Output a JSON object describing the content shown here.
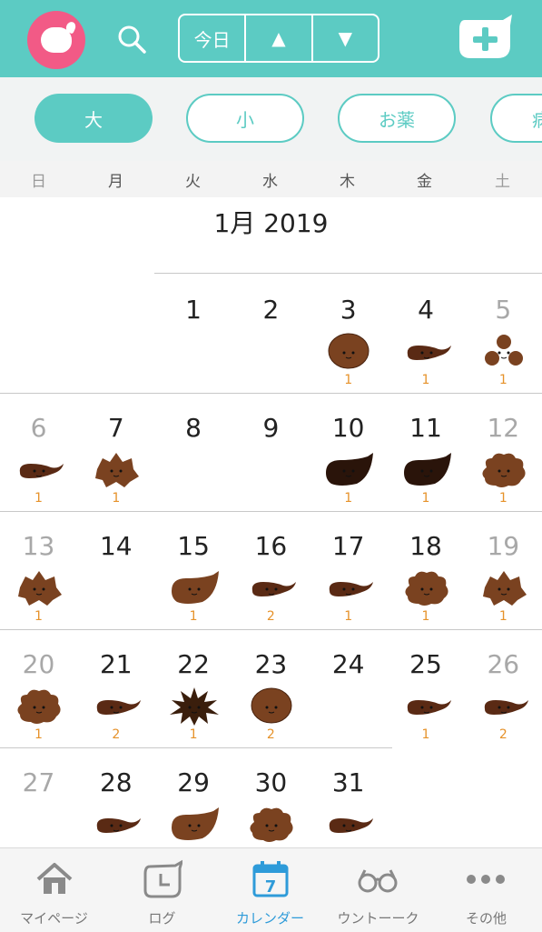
{
  "header": {
    "today_label": "今日",
    "prev_label": "▲",
    "next_label": "▼",
    "accent_color": "#5ccbc3",
    "app_icon_color": "#f25a86"
  },
  "filters": [
    "大",
    "小",
    "お薬",
    "病"
  ],
  "weekdays": [
    "日",
    "月",
    "火",
    "水",
    "木",
    "金",
    "土"
  ],
  "month_title": "1月 2019",
  "days": [
    {
      "day": "1"
    },
    {
      "day": "2"
    },
    {
      "day": "3",
      "type": "round",
      "count": "1"
    },
    {
      "day": "4",
      "type": "tadpole",
      "count": "1"
    },
    {
      "day": "5",
      "type": "pellets",
      "count": "1"
    },
    {
      "day": "6",
      "type": "tadpole",
      "count": "1"
    },
    {
      "day": "7",
      "type": "spiky",
      "count": "1"
    },
    {
      "day": "8"
    },
    {
      "day": "9"
    },
    {
      "day": "10",
      "type": "blob-dark",
      "count": "1"
    },
    {
      "day": "11",
      "type": "blob-dark",
      "count": "1"
    },
    {
      "day": "12",
      "type": "lumpy",
      "count": "1"
    },
    {
      "day": "13",
      "type": "spiky",
      "count": "1"
    },
    {
      "day": "14"
    },
    {
      "day": "15",
      "type": "blob",
      "count": "1"
    },
    {
      "day": "16",
      "type": "tadpole",
      "count": "2"
    },
    {
      "day": "17",
      "type": "tadpole",
      "count": "1"
    },
    {
      "day": "18",
      "type": "lumpy",
      "count": "1"
    },
    {
      "day": "19",
      "type": "spiky",
      "count": "1"
    },
    {
      "day": "20",
      "type": "lumpy",
      "count": "1"
    },
    {
      "day": "21",
      "type": "tadpole",
      "count": "2"
    },
    {
      "day": "22",
      "type": "burst",
      "count": "1"
    },
    {
      "day": "23",
      "type": "round",
      "count": "2"
    },
    {
      "day": "24"
    },
    {
      "day": "25",
      "type": "tadpole",
      "count": "1"
    },
    {
      "day": "26",
      "type": "tadpole",
      "count": "2"
    },
    {
      "day": "27"
    },
    {
      "day": "28",
      "type": "tadpole"
    },
    {
      "day": "29",
      "type": "blob"
    },
    {
      "day": "30",
      "type": "lumpy"
    },
    {
      "day": "31",
      "type": "tadpole"
    }
  ],
  "tabs": [
    {
      "label": "マイページ",
      "icon": "home-icon"
    },
    {
      "label": "ログ",
      "icon": "log-icon"
    },
    {
      "label": "カレンダー",
      "icon": "calendar-icon",
      "calendar_number": "7",
      "active": true
    },
    {
      "label": "ウントーーク",
      "icon": "glasses-icon"
    },
    {
      "label": "その他",
      "icon": "more-icon"
    }
  ]
}
